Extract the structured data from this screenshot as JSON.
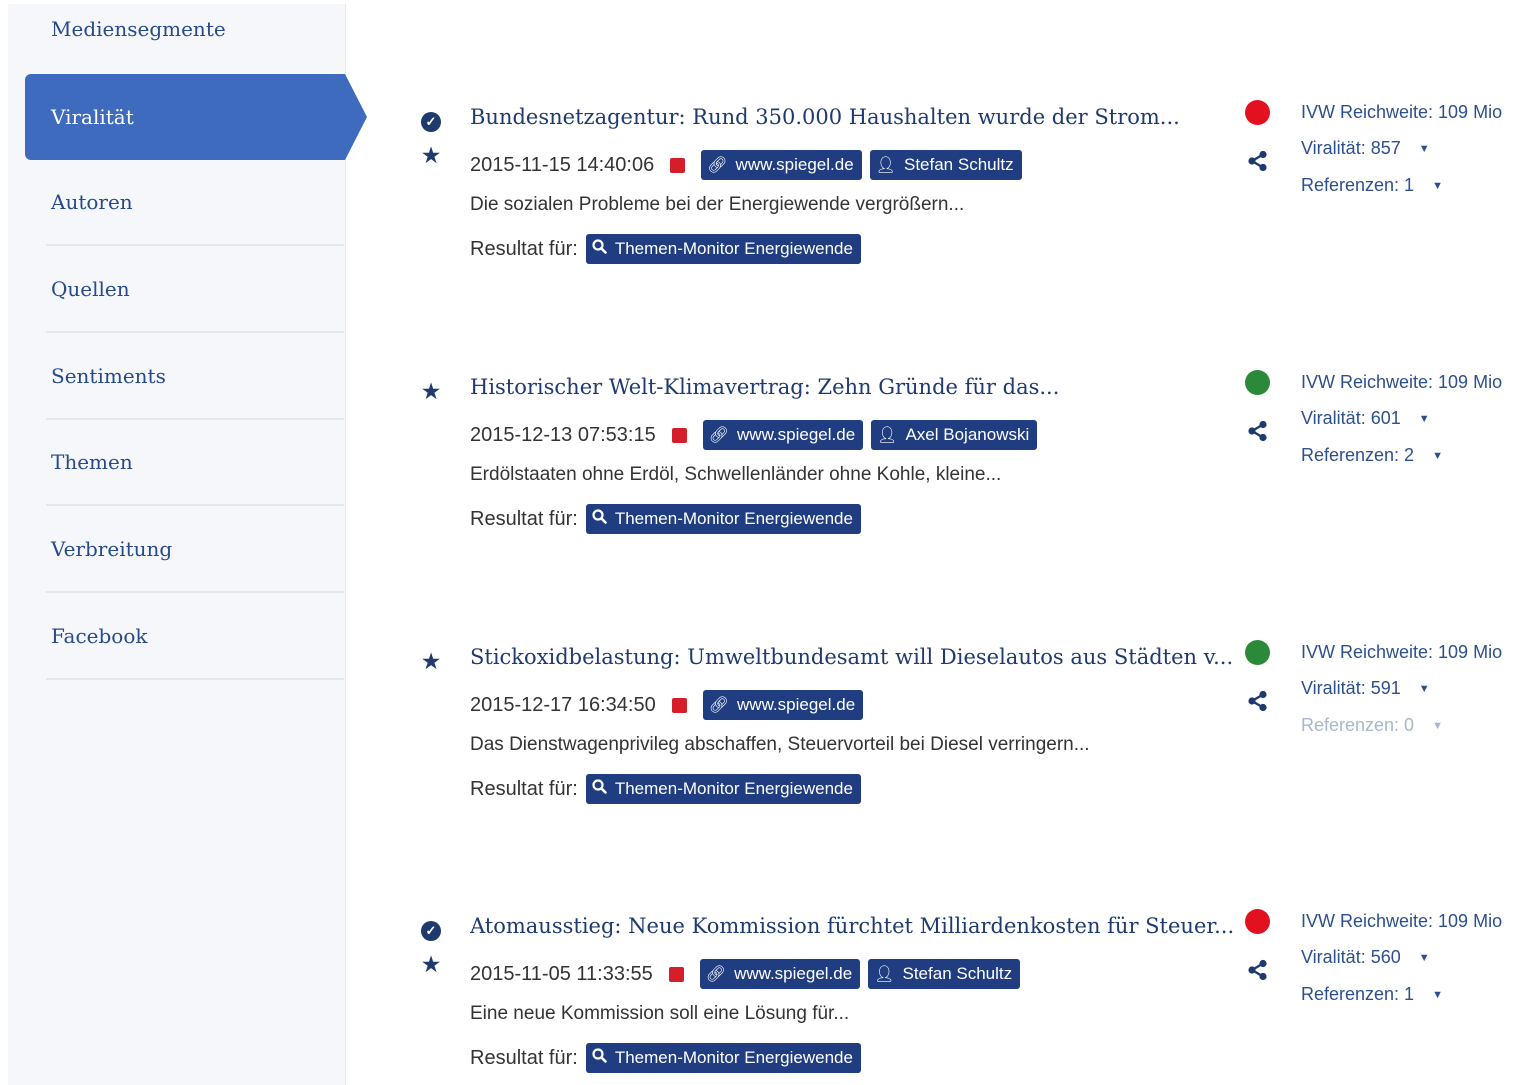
{
  "sidebar": {
    "items": [
      {
        "label": "Mediensegmente"
      },
      {
        "label": "Viralität",
        "active": true
      },
      {
        "label": "Autoren"
      },
      {
        "label": "Quellen"
      },
      {
        "label": "Sentiments"
      },
      {
        "label": "Themen"
      },
      {
        "label": "Verbreitung"
      },
      {
        "label": "Facebook"
      }
    ]
  },
  "colors": {
    "accent": "#3e6bbd",
    "badge": "#1f3d80",
    "status_red": "#e3101f",
    "status_green": "#2a8a3a"
  },
  "result_label": "Resultat für:",
  "articles": [
    {
      "title": "Bundesnetzagentur: Rund 350.000 Haushalten wurde der Strom...",
      "date": "2015-11-15 14:40:06",
      "source": "www.spiegel.de",
      "author": "Stefan Schultz",
      "description": "Die sozialen Probleme bei der Energiewende vergrößern...",
      "result": "Themen-Monitor Energiewende",
      "status": "red",
      "checked": true,
      "reach": "IVW Reichweite: 109 Mio",
      "virality": "Viralität: 857",
      "references": "Referenzen: 1"
    },
    {
      "title": "Historischer Welt-Klimavertrag: Zehn Gründe für das...",
      "date": "2015-12-13 07:53:15",
      "source": "www.spiegel.de",
      "author": "Axel Bojanowski",
      "description": "Erdölstaaten ohne Erdöl, Schwellenländer ohne Kohle, kleine...",
      "result": "Themen-Monitor Energiewende",
      "status": "green",
      "checked": false,
      "reach": "IVW Reichweite: 109 Mio",
      "virality": "Viralität: 601",
      "references": "Referenzen: 2"
    },
    {
      "title": "Stickoxidbelastung: Umweltbundesamt will Dieselautos aus Städten v...",
      "date": "2015-12-17 16:34:50",
      "source": "www.spiegel.de",
      "author": "",
      "description": "Das Dienstwagenprivileg abschaffen, Steuervorteil bei Diesel verringern...",
      "result": "Themen-Monitor Energiewende",
      "status": "green",
      "checked": false,
      "reach": "IVW Reichweite: 109 Mio",
      "virality": "Viralität: 591",
      "references": "Referenzen: 0"
    },
    {
      "title": "Atomausstieg: Neue Kommission fürchtet Milliardenkosten für Steuer...",
      "date": "2015-11-05 11:33:55",
      "source": "www.spiegel.de",
      "author": "Stefan Schultz",
      "description": "Eine neue Kommission soll eine Lösung für...",
      "result": "Themen-Monitor Energiewende",
      "status": "red",
      "checked": true,
      "reach": "IVW Reichweite: 109 Mio",
      "virality": "Viralität: 560",
      "references": "Referenzen: 1"
    }
  ]
}
